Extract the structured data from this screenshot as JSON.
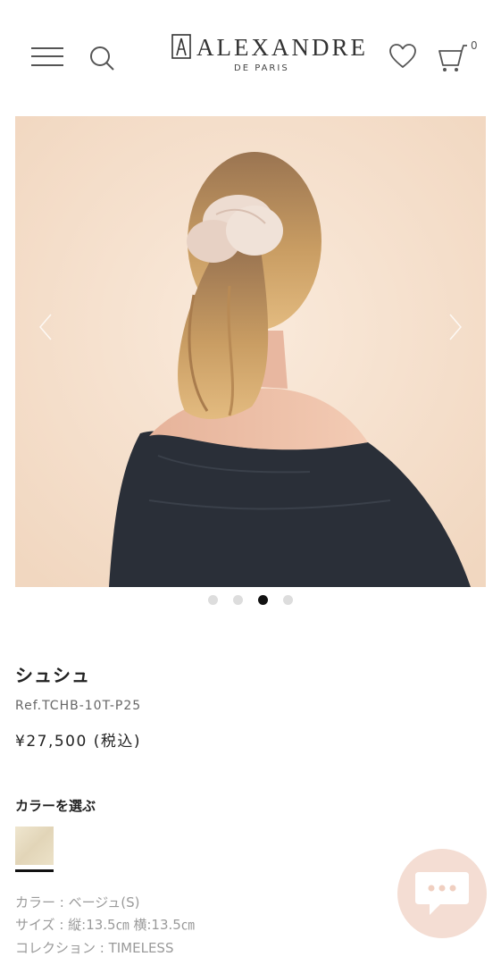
{
  "header": {
    "logo": {
      "name": "ALEXANDRE",
      "subtitle": "DE PARIS"
    },
    "cart_count": "0",
    "icons": [
      "menu-icon",
      "search-icon",
      "heart-icon",
      "cart-icon"
    ]
  },
  "carousel": {
    "slide_count": 4,
    "active_index": 2
  },
  "product": {
    "title": "シュシュ",
    "ref": "Ref.TCHB-10T-P25",
    "price": "¥27,500 (税込)",
    "color_section_label": "カラーを選ぶ",
    "selected_swatch_color": "#e7dcc2",
    "specs": {
      "color": "カラー : ベージュ(S)",
      "size": "サイズ : 縦:13.5㎝ 横:13.5㎝",
      "collection": "コレクション : TIMELESS"
    }
  },
  "colors": {
    "chat_bubble": "#f4ddd3",
    "photo_background": "#f6e1cc",
    "dot_active": "#111111",
    "dot_inactive": "#dddddd"
  }
}
